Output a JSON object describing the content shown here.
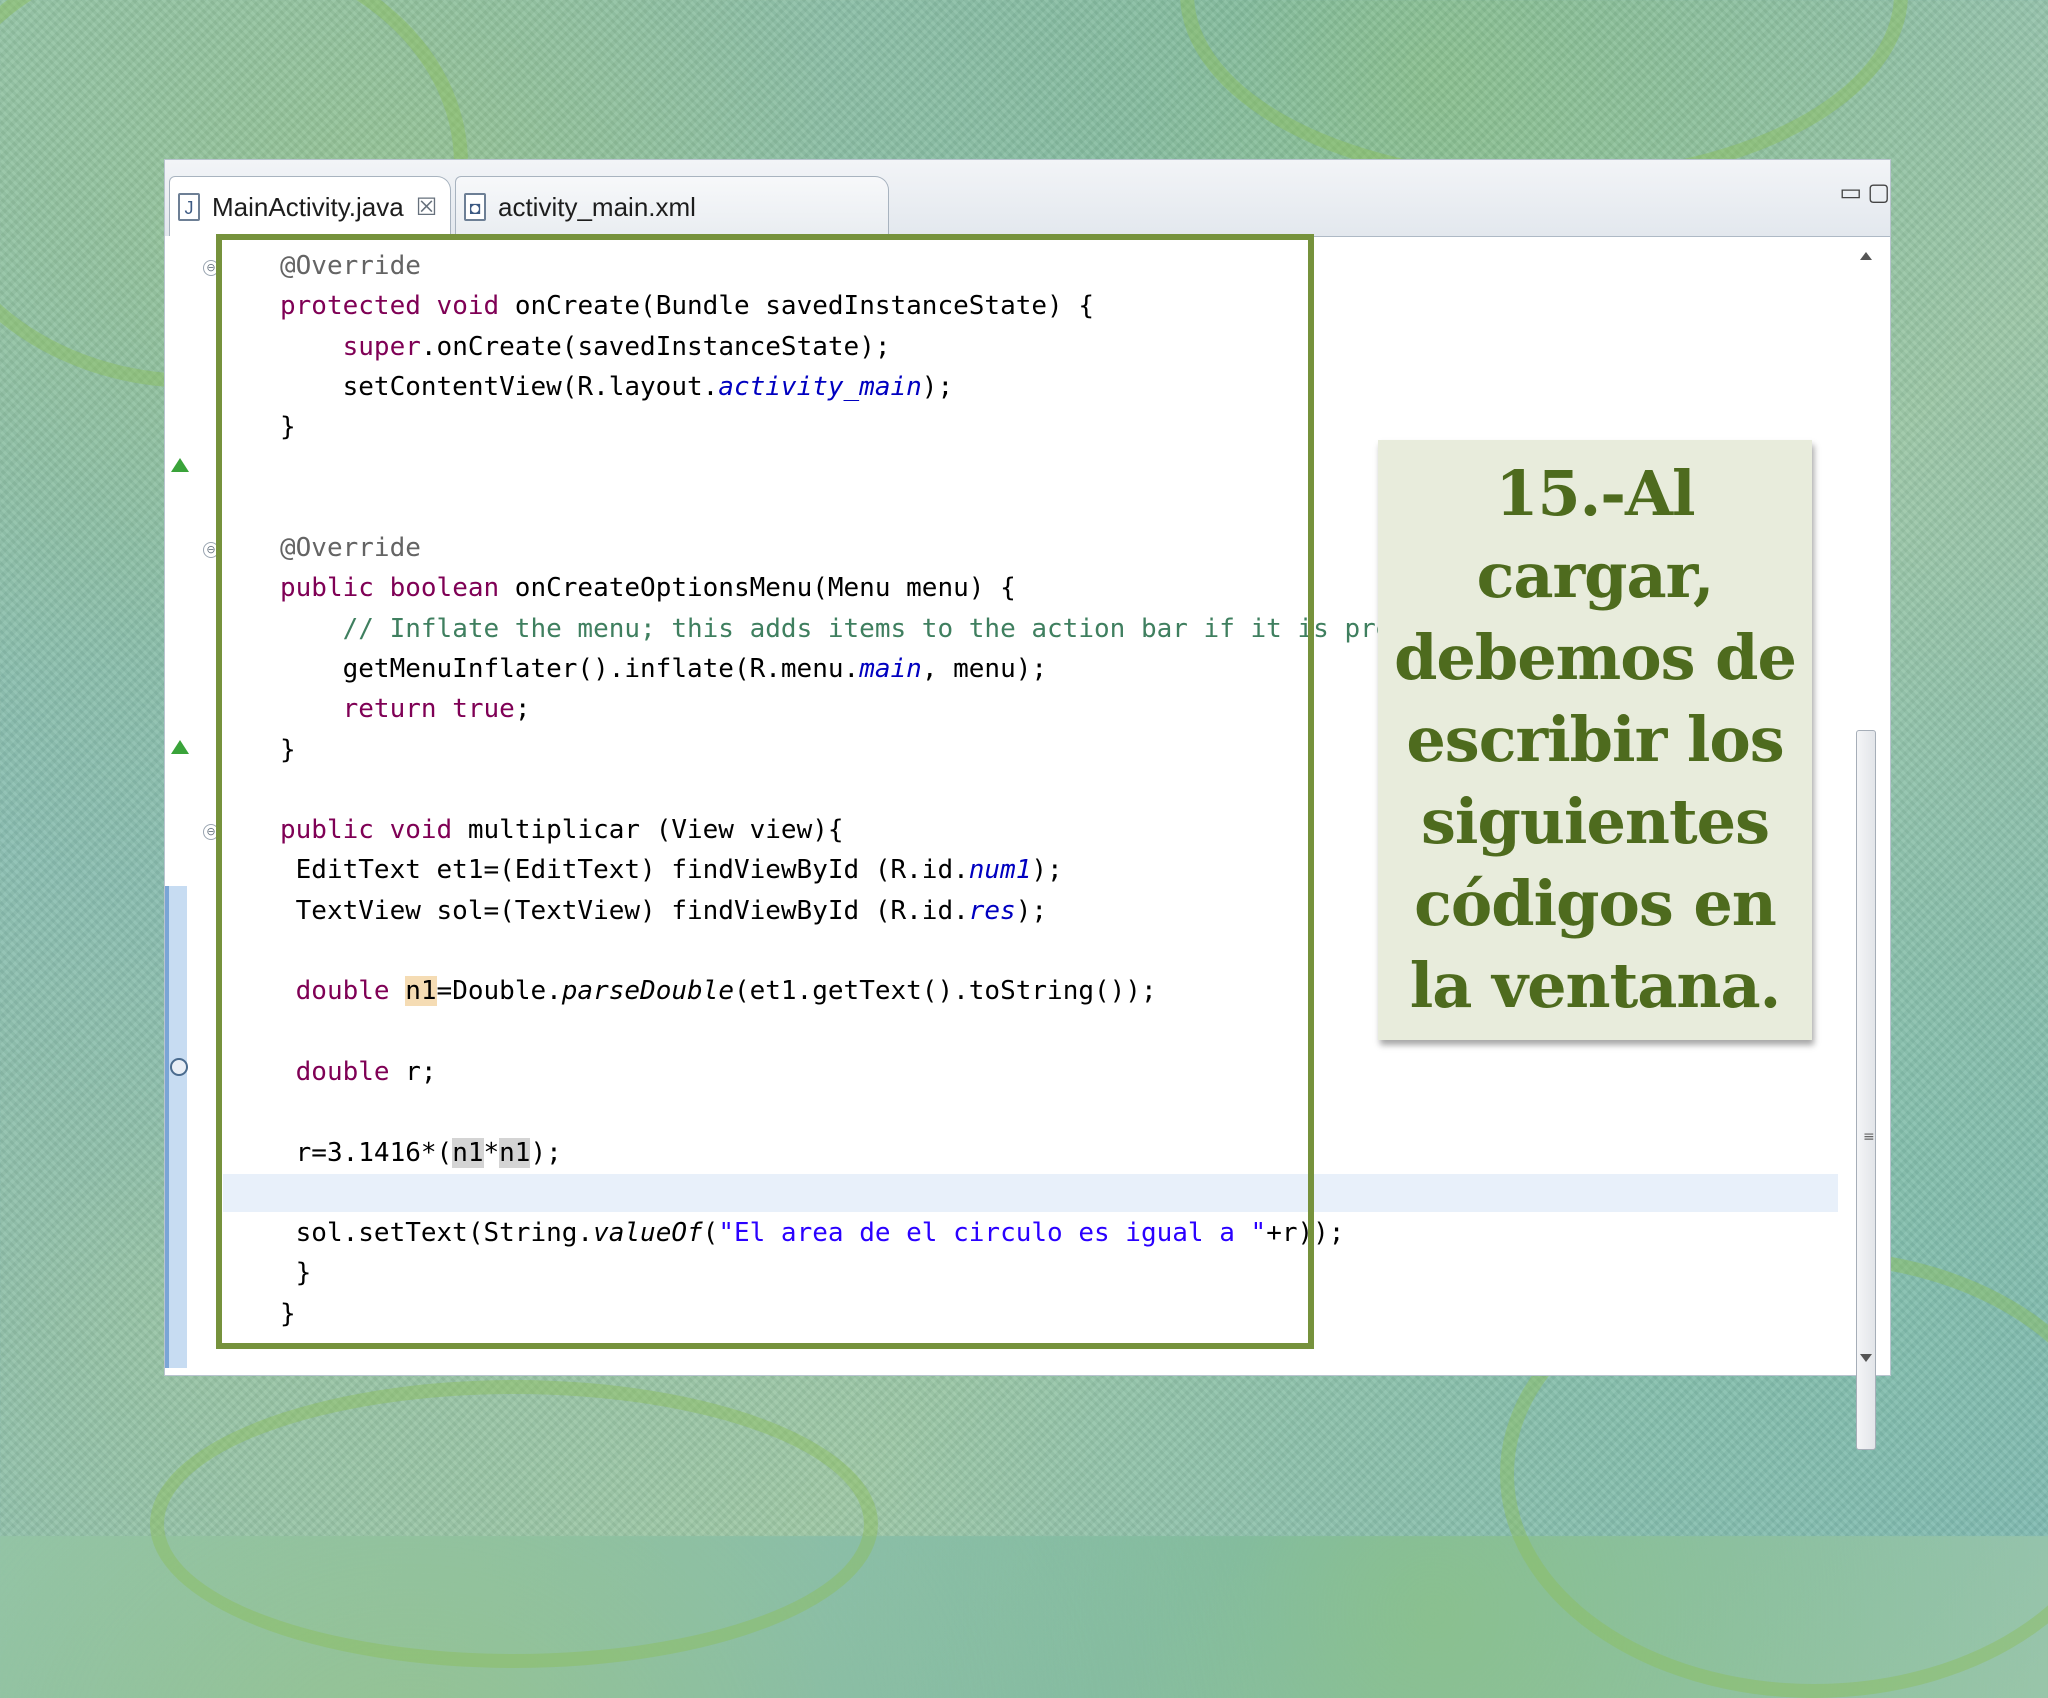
{
  "tabs": [
    {
      "label": "MainActivity.java",
      "icon": "java-file-icon",
      "active": true
    },
    {
      "label": "activity_main.xml",
      "icon": "xml-file-icon",
      "active": false
    }
  ],
  "window_controls": {
    "minimize": "▭",
    "maximize": "▢"
  },
  "note": {
    "text": "15.-Al cargar, debemos de escribir los siguientes códigos en la ventana."
  },
  "colors": {
    "frame": "#76923c",
    "note_text": "#4e6b1e",
    "keyword": "#7f0055",
    "comment": "#3f7f5f",
    "string": "#2a00ff",
    "field": "#0000c0"
  },
  "code_lines": [
    "@Override",
    "protected void onCreate(Bundle savedInstanceState) {",
    "    super.onCreate(savedInstanceState);",
    "    setContentView(R.layout.activity_main);",
    "}",
    "",
    "",
    "@Override",
    "public boolean onCreateOptionsMenu(Menu menu) {",
    "    // Inflate the menu; this adds items to the action bar if it is present.",
    "    getMenuInflater().inflate(R.menu.main, menu);",
    "    return true;",
    "}",
    "",
    "public void multiplicar (View view){",
    " EditText et1=(EditText) findViewById (R.id.num1);",
    " TextView sol=(TextView) findViewById (R.id.res);",
    "",
    " double n1=Double.parseDouble(et1.getText().toString());",
    "",
    " double r;",
    "",
    " r=3.1416*(n1*n1);",
    "",
    " sol.setText(String.valueOf(\"El area de el circulo es igual a \"+r));",
    " }",
    "}"
  ]
}
